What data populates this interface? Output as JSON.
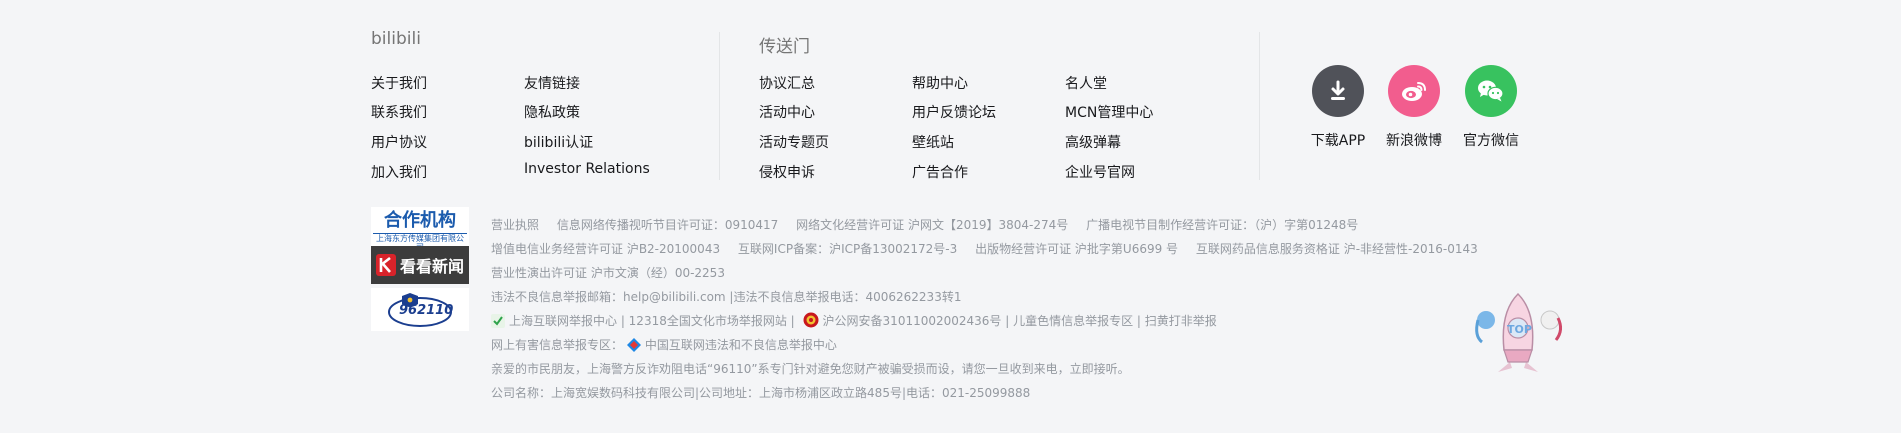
{
  "brand": {
    "title": "bilibili"
  },
  "portal": {
    "title": "传送门"
  },
  "left_links": [
    [
      "关于我们",
      "友情链接"
    ],
    [
      "联系我们",
      "隐私政策"
    ],
    [
      "用户协议",
      "bilibili认证"
    ],
    [
      "加入我们",
      "Investor Relations"
    ]
  ],
  "portal_links": [
    [
      "协议汇总",
      "帮助中心",
      "名人堂"
    ],
    [
      "活动中心",
      "用户反馈论坛",
      "MCN管理中心"
    ],
    [
      "活动专题页",
      "壁纸站",
      "高级弹幕"
    ],
    [
      "侵权申诉",
      "广告合作",
      "企业号官网"
    ]
  ],
  "social": {
    "download": {
      "label": "下载APP",
      "color": "#505259"
    },
    "weibo": {
      "label": "新浪微博",
      "color": "#f25d8e"
    },
    "wechat": {
      "label": "官方微信",
      "color": "#38c25f"
    }
  },
  "partner": {
    "title": "合作机构",
    "subtitle": "上海东方传媒集团有限公司",
    "news": "看看新闻",
    "police": "962110"
  },
  "info": {
    "line1": [
      "营业执照",
      "信息网络传播视听节目许可证：0910417",
      "网络文化经营许可证 沪网文【2019】3804-274号",
      "广播电视节目制作经营许可证：（沪）字第01248号"
    ],
    "line2": [
      "增值电信业务经营许可证 沪B2-20100043",
      "互联网ICP备案：沪ICP备13002172号-3",
      "出版物经营许可证 沪批字第U6699 号",
      "互联网药品信息服务资格证 沪-非经营性-2016-0143"
    ],
    "line3": "营业性演出许可证 沪市文演（经）00-2253",
    "line4": "违法不良信息举报邮箱：help@bilibili.com |违法不良信息举报电话：4006262233转1",
    "line5a": "上海互联网举报中心 | 12318全国文化市场举报网站 |",
    "line5b": "沪公网安备31011002002436号 | 儿童色情信息举报专区 | 扫黄打非举报",
    "line6a": "网上有害信息举报专区：",
    "line6b": "中国互联网违法和不良信息举报中心",
    "line7": "亲爱的市民朋友，上海警方反诈劝阻电话“96110”系专门针对避免您财产被骗受损而设，请您一旦收到来电，立即接听。",
    "line8": "公司名称：上海宽娱数码科技有限公司|公司地址：上海市杨浦区政立路485号|电话：021-25099888"
  },
  "top_button": {
    "label": "TOP"
  }
}
